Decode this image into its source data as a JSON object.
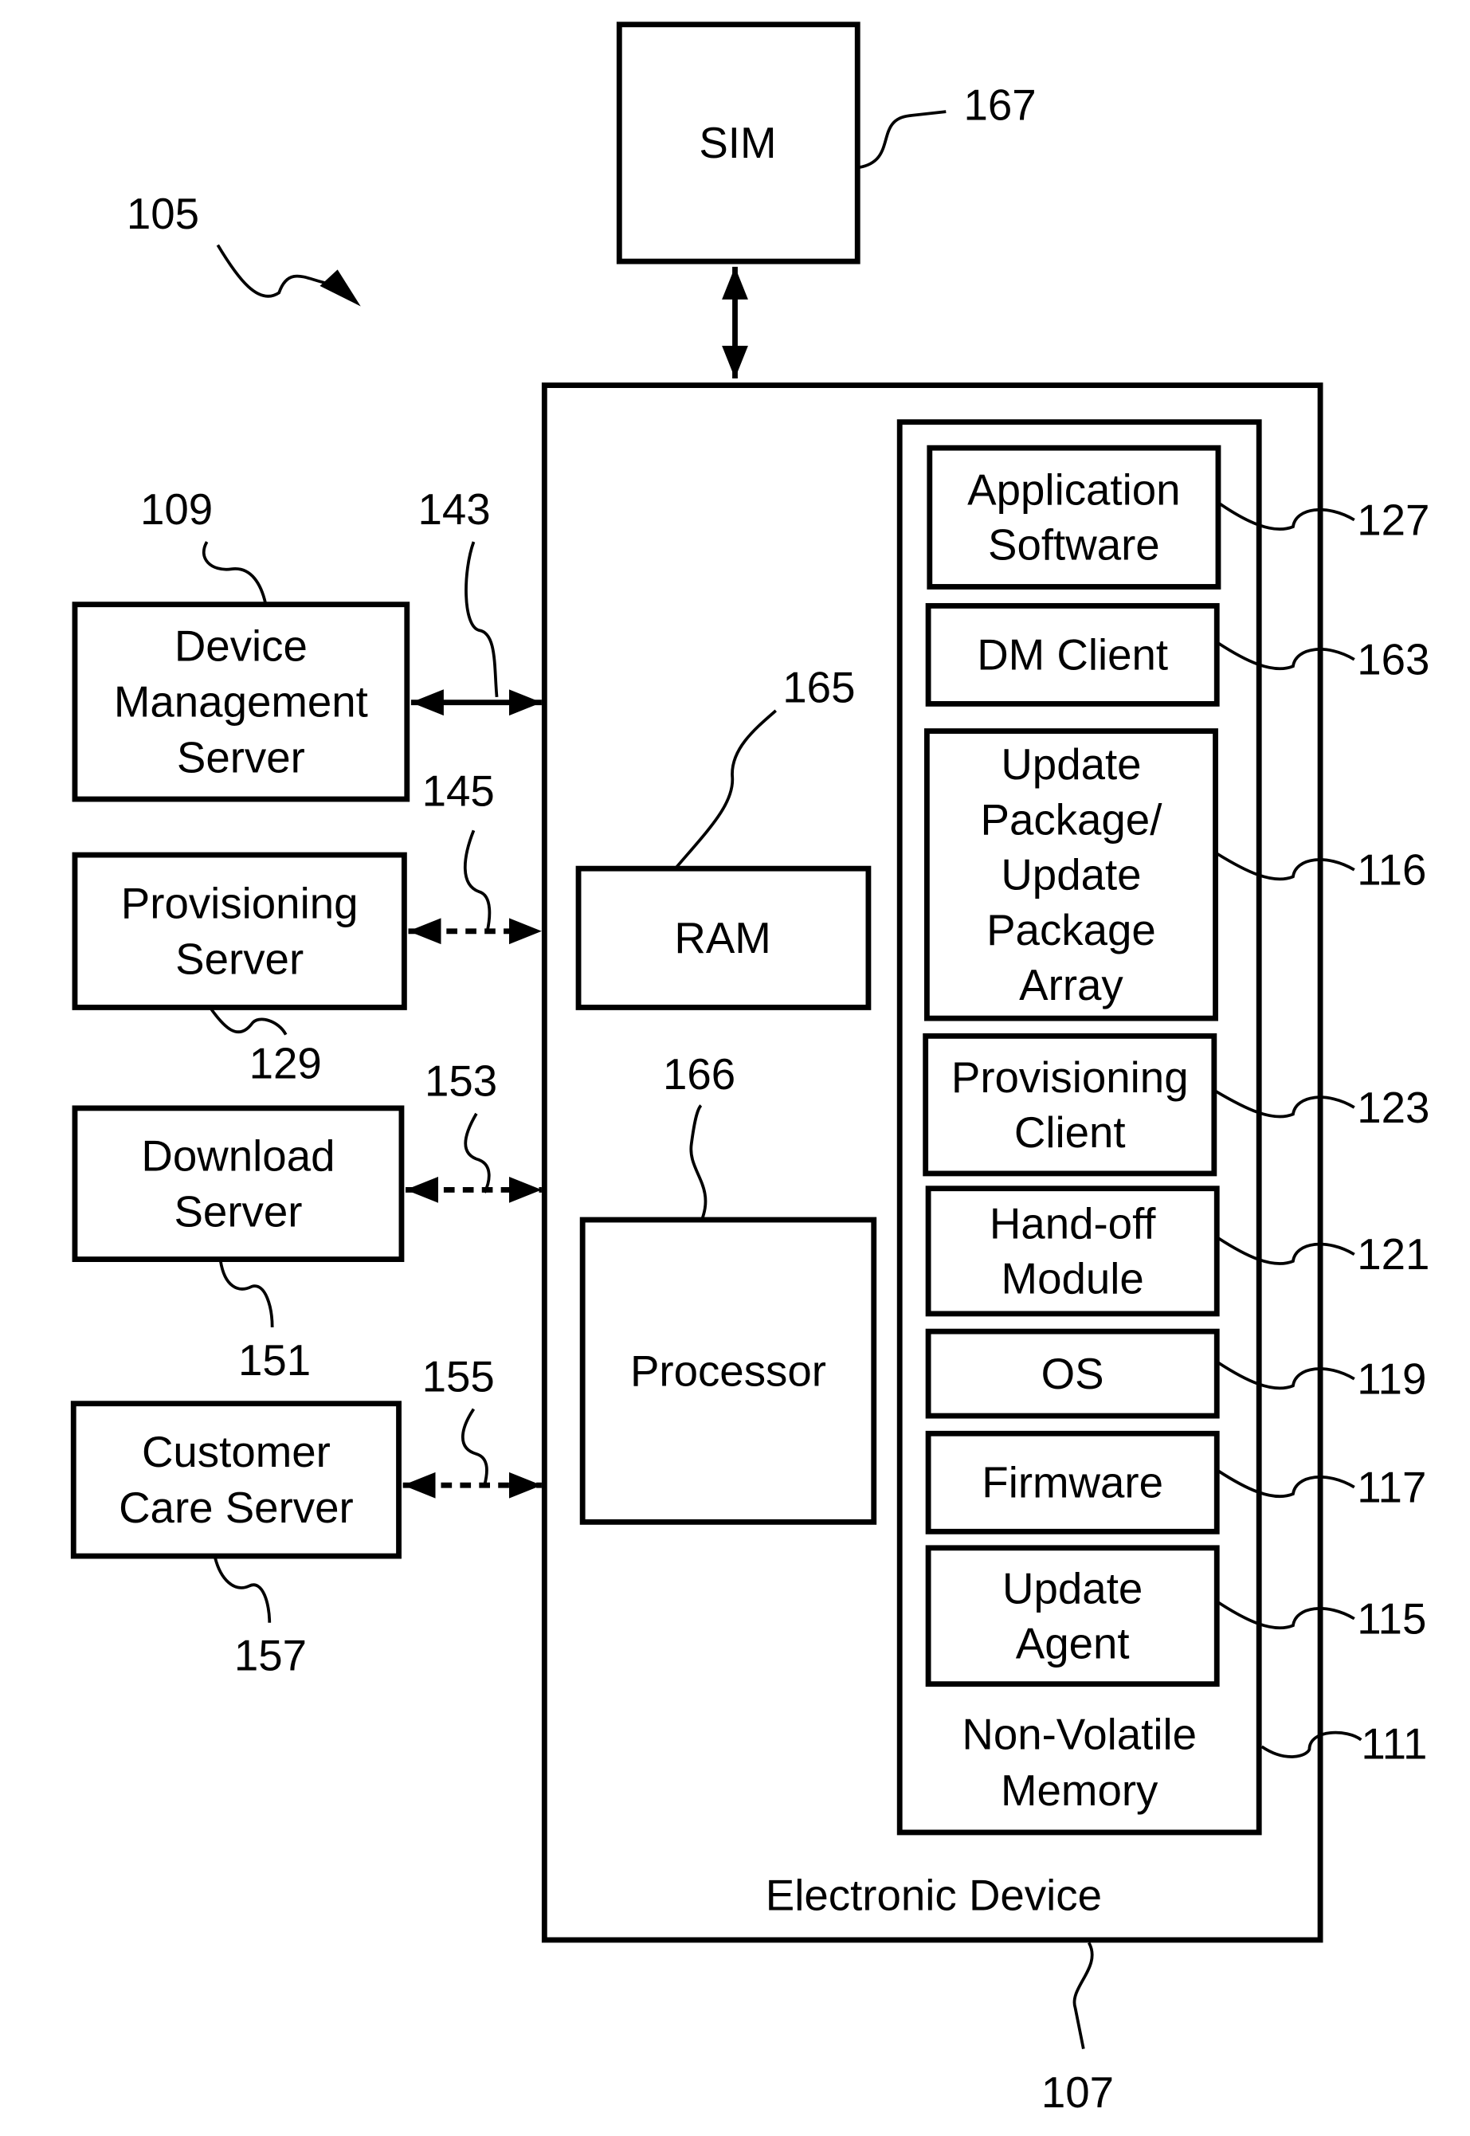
{
  "figure": {
    "system_ref": "105",
    "sim": {
      "label": "SIM",
      "ref": "167"
    },
    "device": {
      "label": "Electronic Device",
      "ref": "107"
    },
    "ram": {
      "label": "RAM",
      "ref": "165"
    },
    "processor": {
      "label": "Processor",
      "ref": "166"
    },
    "nvm": {
      "label_lines": [
        "Non-Volatile",
        "Memory"
      ],
      "ref": "111"
    },
    "nvm_items": [
      {
        "lines": [
          "Application",
          "Software"
        ],
        "ref": "127"
      },
      {
        "lines": [
          "DM Client"
        ],
        "ref": "163"
      },
      {
        "lines": [
          "Update",
          "Package/",
          "Update",
          "Package",
          "Array"
        ],
        "ref": "116"
      },
      {
        "lines": [
          "Provisioning",
          "Client"
        ],
        "ref": "123"
      },
      {
        "lines": [
          "Hand-off",
          "Module"
        ],
        "ref": "121"
      },
      {
        "lines": [
          "OS"
        ],
        "ref": "119"
      },
      {
        "lines": [
          "Firmware"
        ],
        "ref": "117"
      },
      {
        "lines": [
          "Update",
          "Agent"
        ],
        "ref": "115"
      }
    ],
    "servers": [
      {
        "lines": [
          "Device",
          "Management",
          "Server"
        ],
        "ref": "109",
        "link_ref": "143",
        "link_style": "solid"
      },
      {
        "lines": [
          "Provisioning",
          "Server"
        ],
        "ref": "129",
        "link_ref": "145",
        "link_style": "dashed"
      },
      {
        "lines": [
          "Download",
          "Server"
        ],
        "ref": "151",
        "link_ref": "153",
        "link_style": "dashed"
      },
      {
        "lines": [
          "Customer",
          "Care Server"
        ],
        "ref": "157",
        "link_ref": "155",
        "link_style": "dashed"
      }
    ]
  }
}
